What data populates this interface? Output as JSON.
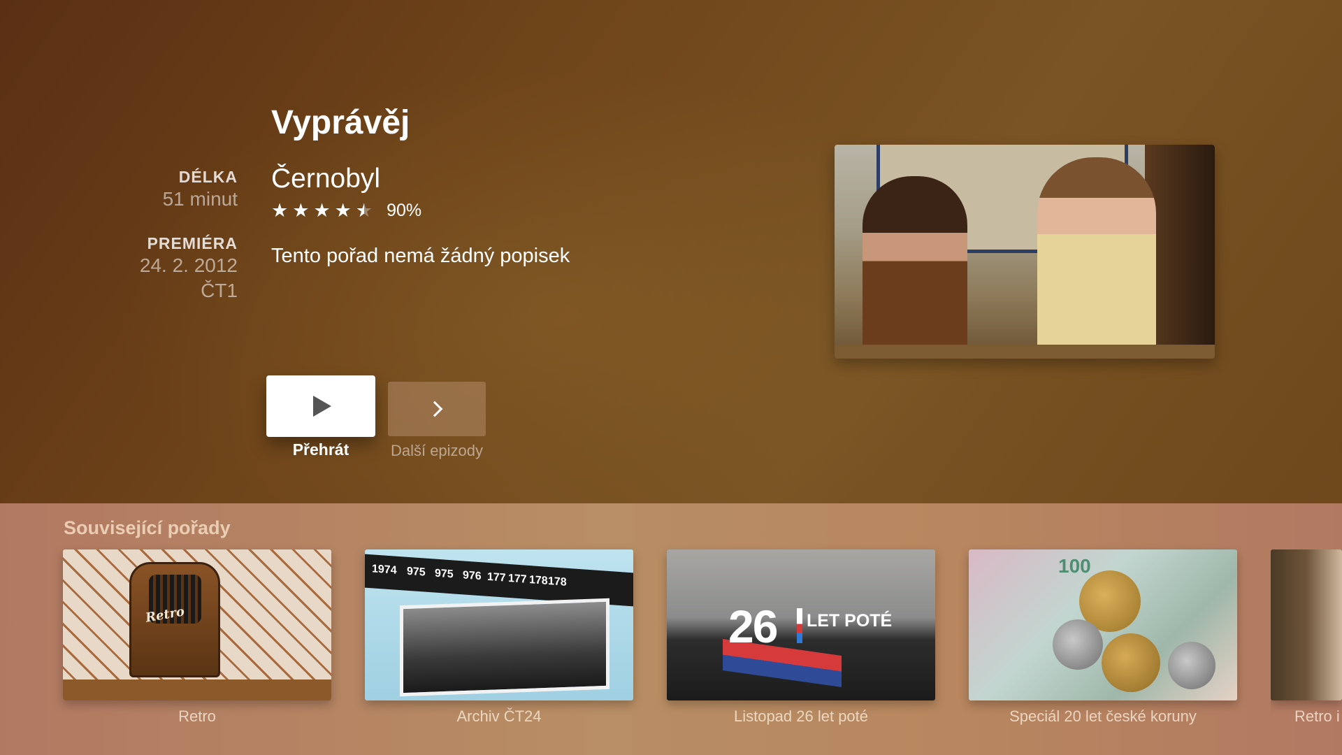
{
  "show": {
    "title": "Vyprávěj",
    "episode_title": "Černobyl",
    "rating_percent": "90%",
    "rating_stars": 4.5,
    "description": "Tento pořad nemá žádný popisek"
  },
  "meta": {
    "duration_label": "DÉLKA",
    "duration_value": "51 minut",
    "premiere_label": "PREMIÉRA",
    "premiere_date": "24. 2. 2012",
    "premiere_channel": "ČT1"
  },
  "actions": {
    "play_label": "Přehrát",
    "next_label": "Další epizody"
  },
  "related": {
    "heading": "Související pořady",
    "items": [
      {
        "label": "Retro",
        "image_text": "Retro"
      },
      {
        "label": "Archiv ČT24",
        "image_text": [
          "1974",
          "975",
          "975",
          "976",
          "177",
          "177",
          "178",
          "178"
        ]
      },
      {
        "label": "Listopad 26 let poté",
        "image_text": {
          "number": "26",
          "subtitle": "LET POTÉ"
        }
      },
      {
        "label": "Speciál 20 let české koruny",
        "image_text": "100"
      },
      {
        "label": "Retro i"
      }
    ]
  },
  "icons": {
    "play": "play-icon",
    "next": "chevron-right-icon",
    "star": "star-icon"
  }
}
